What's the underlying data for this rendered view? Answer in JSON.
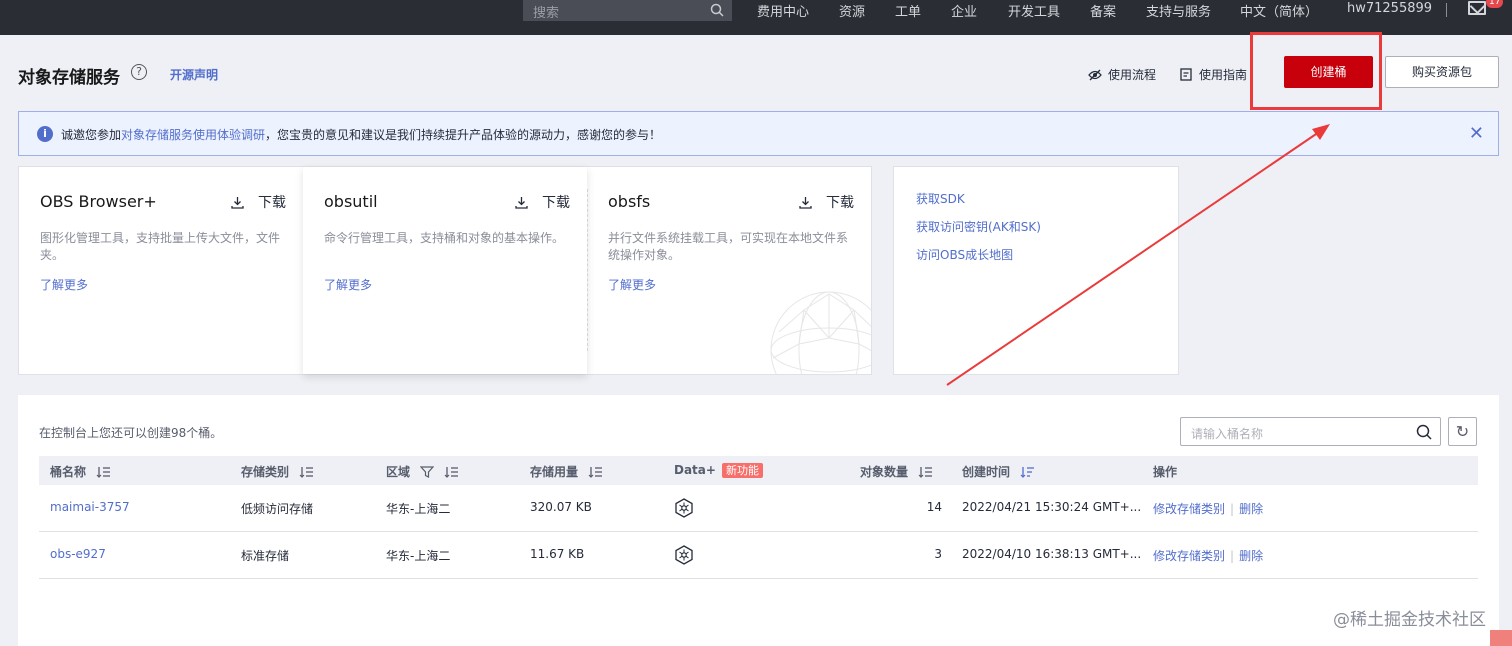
{
  "topnav": {
    "search_placeholder": "搜索",
    "items": [
      "费用中心",
      "资源",
      "工单",
      "企业",
      "开发工具",
      "备案",
      "支持与服务",
      "中文（简体）",
      "hw71255899"
    ],
    "mail_badge": "17"
  },
  "header": {
    "title": "对象存储服务",
    "open_source": "开源声明",
    "flow_link": "使用流程",
    "guide_link": "使用指南",
    "create_button": "创建桶",
    "buy_button": "购买资源包"
  },
  "notice": {
    "prefix": "诚邀您参加",
    "link": "对象存储服务使用体验调研",
    "suffix": "，您宝贵的意见和建议是我们持续提升产品体验的源动力，感谢您的参与！"
  },
  "tools": [
    {
      "name": "OBS Browser+",
      "download": "下载",
      "desc": "图形化管理工具，支持批量上传大文件，文件夹。",
      "more": "了解更多"
    },
    {
      "name": "obsutil",
      "download": "下载",
      "desc": "命令行管理工具，支持桶和对象的基本操作。",
      "more": "了解更多"
    },
    {
      "name": "obsfs",
      "download": "下载",
      "desc": "并行文件系统挂载工具，可实现在本地文件系统操作对象。",
      "more": "了解更多"
    }
  ],
  "links": [
    "获取SDK",
    "获取访问密钥(AK和SK)",
    "访问OBS成长地图"
  ],
  "buckets": {
    "quota_text": "在控制台上您还可以创建98个桶。",
    "search_placeholder": "请输入桶名称",
    "columns": {
      "name": "桶名称",
      "storage_class": "存储类别",
      "region": "区域",
      "usage": "存储用量",
      "dataplus": "Data+",
      "new_tag": "新功能",
      "objects": "对象数量",
      "created": "创建时间",
      "actions": "操作"
    },
    "rows": [
      {
        "name": "maimai-3757",
        "storage_class": "低频访问存储",
        "region": "华东-上海二",
        "usage": "320.07 KB",
        "objects": "14",
        "created": "2022/04/21 15:30:24 GMT+...",
        "action_modify": "修改存储类别",
        "action_delete": "删除"
      },
      {
        "name": "obs-e927",
        "storage_class": "标准存储",
        "region": "华东-上海二",
        "usage": "11.67 KB",
        "objects": "3",
        "created": "2022/04/10 16:38:13 GMT+...",
        "action_modify": "修改存储类别",
        "action_delete": "删除"
      }
    ]
  },
  "watermark": "@稀土掘金技术社区",
  "colors": {
    "brand_red": "#c7000b",
    "link_blue": "#526ecc",
    "annotation_red": "#ea3a3a"
  }
}
